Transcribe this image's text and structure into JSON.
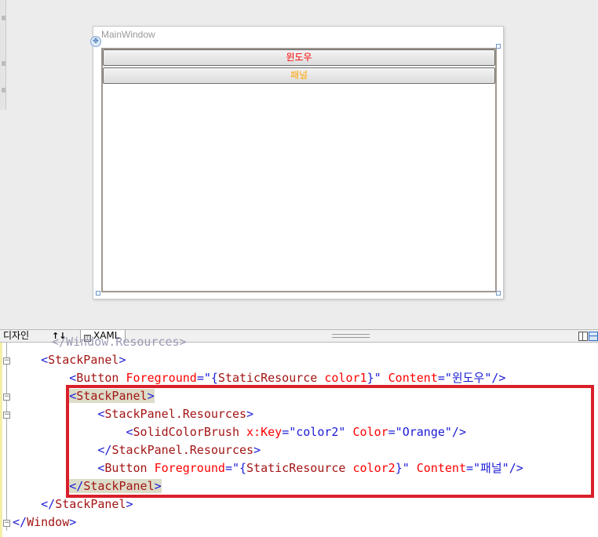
{
  "designer": {
    "window_title": "MainWindow",
    "buttons": [
      {
        "label": "윈도우",
        "foreground": "#ff0000"
      },
      {
        "label": "패널",
        "foreground": "#ffa500"
      }
    ]
  },
  "tabs": {
    "design": "디자인",
    "swap": "↑↓",
    "xaml": "XAML"
  },
  "code": {
    "cutoff_line": "</Window.Resources>",
    "lines": [
      {
        "indent": "    ",
        "parts": [
          [
            "b",
            "<"
          ],
          [
            "m",
            "StackPanel"
          ],
          [
            "b",
            ">"
          ]
        ]
      },
      {
        "indent": "        ",
        "parts": [
          [
            "b",
            "<"
          ],
          [
            "m",
            "Button"
          ],
          [
            "r",
            " Foreground"
          ],
          [
            "b",
            "=\"{"
          ],
          [
            "m",
            "StaticResource"
          ],
          [
            "r",
            " color1"
          ],
          [
            "b",
            "}\""
          ],
          [
            "r",
            " Content"
          ],
          [
            "b",
            "=\"윈도우\"/>"
          ]
        ]
      },
      {
        "indent": "        ",
        "hl": true,
        "parts": [
          [
            "b",
            "<"
          ],
          [
            "m",
            "StackPanel"
          ],
          [
            "b",
            ">"
          ]
        ]
      },
      {
        "indent": "            ",
        "parts": [
          [
            "b",
            "<"
          ],
          [
            "m",
            "StackPanel.Resources"
          ],
          [
            "b",
            ">"
          ]
        ]
      },
      {
        "indent": "                ",
        "parts": [
          [
            "b",
            "<"
          ],
          [
            "m",
            "SolidColorBrush"
          ],
          [
            "r",
            " x:Key"
          ],
          [
            "b",
            "=\"color2\""
          ],
          [
            "r",
            " Color"
          ],
          [
            "b",
            "=\"Orange\"/>"
          ]
        ]
      },
      {
        "indent": "            ",
        "parts": [
          [
            "b",
            "</"
          ],
          [
            "m",
            "StackPanel.Resources"
          ],
          [
            "b",
            ">"
          ]
        ]
      },
      {
        "indent": "            ",
        "parts": [
          [
            "b",
            "<"
          ],
          [
            "m",
            "Button"
          ],
          [
            "r",
            " Foreground"
          ],
          [
            "b",
            "=\"{"
          ],
          [
            "m",
            "StaticResource"
          ],
          [
            "r",
            " color2"
          ],
          [
            "b",
            "}\""
          ],
          [
            "r",
            " Content"
          ],
          [
            "b",
            "=\"패널\"/>"
          ]
        ]
      },
      {
        "indent": "        ",
        "hl": true,
        "parts": [
          [
            "b",
            "</"
          ],
          [
            "m",
            "StackPanel"
          ],
          [
            "b",
            ">"
          ]
        ]
      },
      {
        "indent": "    ",
        "parts": [
          [
            "b",
            "</"
          ],
          [
            "m",
            "StackPanel"
          ],
          [
            "b",
            ">"
          ]
        ]
      },
      {
        "indent": "",
        "parts": [
          [
            "b",
            "</"
          ],
          [
            "m",
            "Window"
          ],
          [
            "b",
            ">"
          ]
        ]
      }
    ]
  },
  "colors": {
    "attribute": "#ff0000",
    "element": "#a31515",
    "punctuation": "#1b1bd6",
    "annotation_box": "#d9202a"
  }
}
